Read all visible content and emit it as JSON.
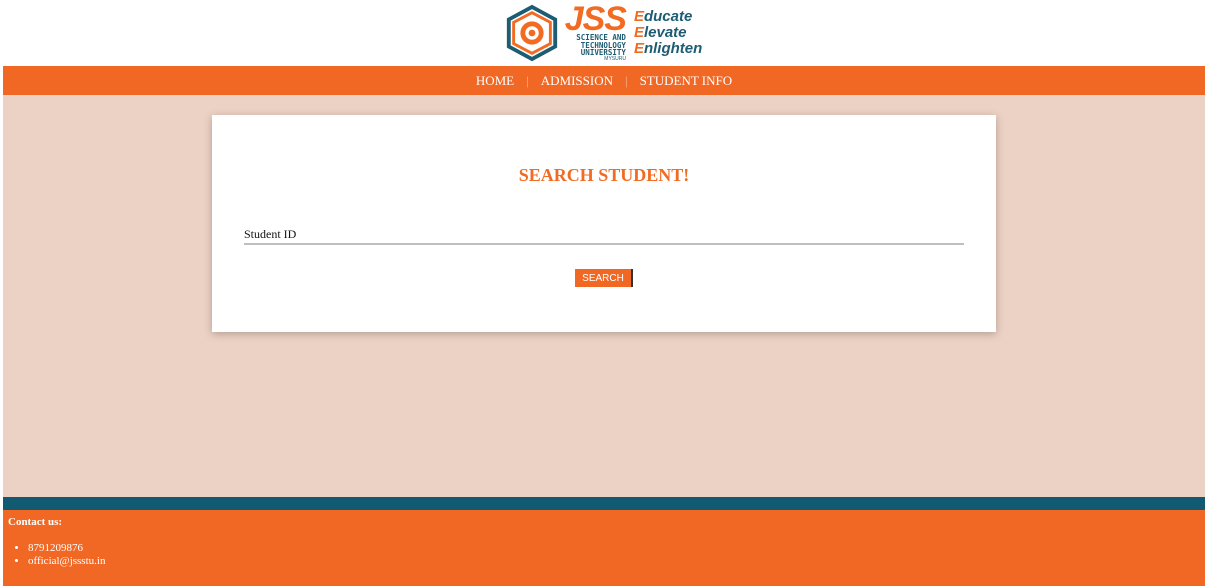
{
  "logo": {
    "brand": "JSS",
    "sub_line1": "SCIENCE AND",
    "sub_line2": "TECHNOLOGY",
    "sub_line3": "UNIVERSITY",
    "city": "MYSURU",
    "motto": [
      {
        "cap": "E",
        "rest": "ducate"
      },
      {
        "cap": "E",
        "rest": "levate"
      },
      {
        "cap": "E",
        "rest": "nlighten"
      }
    ]
  },
  "nav": {
    "items": [
      "HOME",
      "ADMISSION",
      "STUDENT INFO"
    ],
    "separator": "|"
  },
  "search": {
    "title": "SEARCH STUDENT!",
    "placeholder": "Student ID",
    "button_label": "SEARCH"
  },
  "footer": {
    "heading": "Contact us:",
    "contacts": [
      "8791209876",
      "official@jssstu.in"
    ]
  },
  "colors": {
    "accent_orange": "#f16825",
    "teal": "#115a72",
    "page_bg": "#ecd2c4"
  }
}
